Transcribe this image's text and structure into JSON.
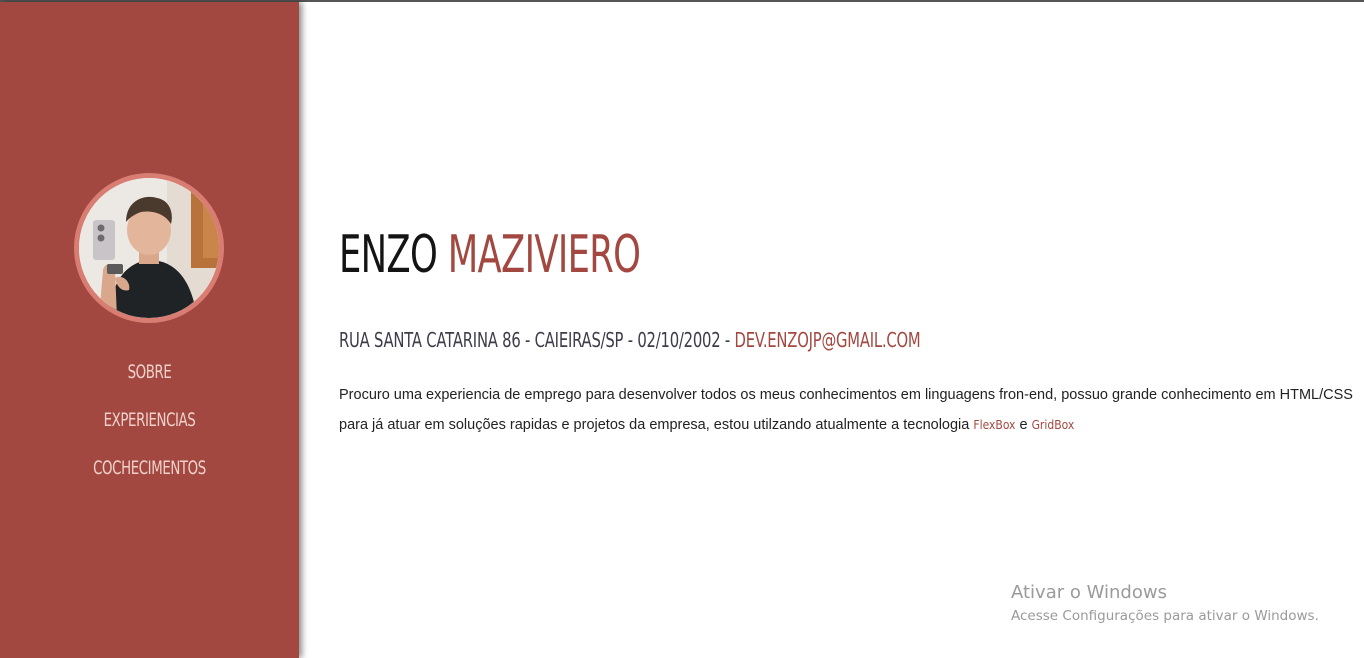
{
  "sidebar": {
    "avatar_label": "profile-photo",
    "nav": [
      {
        "label": "SOBRE"
      },
      {
        "label": "EXPERIENCIAS"
      },
      {
        "label": "COCHECIMENTOS"
      }
    ]
  },
  "main": {
    "first_name": "ENZO",
    "last_name": "MAZIVIERO",
    "contact": {
      "address": "RUA SANTA CATARINA 86 - CAIEIRAS/SP - 02/10/2002 - ",
      "email": "DEV.ENZOJP@GMAIL.COM"
    },
    "about": {
      "text": "Procuro uma experiencia de emprego para desenvolver todos os meus conhecimentos em linguagens fron-end, possuo grande conhecimento em HTML/CSS para já atuar em soluções rapidas e projetos da empresa, estou utilzando atualmente a tecnologia ",
      "tech1": "FlexBox",
      "connector": " e ",
      "tech2": "GridBox"
    }
  },
  "watermark": {
    "title": "Ativar o Windows",
    "subtitle": "Acesse Configurações para ativar o Windows."
  },
  "colors": {
    "sidebar": "#a34840",
    "accent": "#a34840",
    "avatar_ring": "#d97d73",
    "nav_text": "#f0d2cc"
  }
}
